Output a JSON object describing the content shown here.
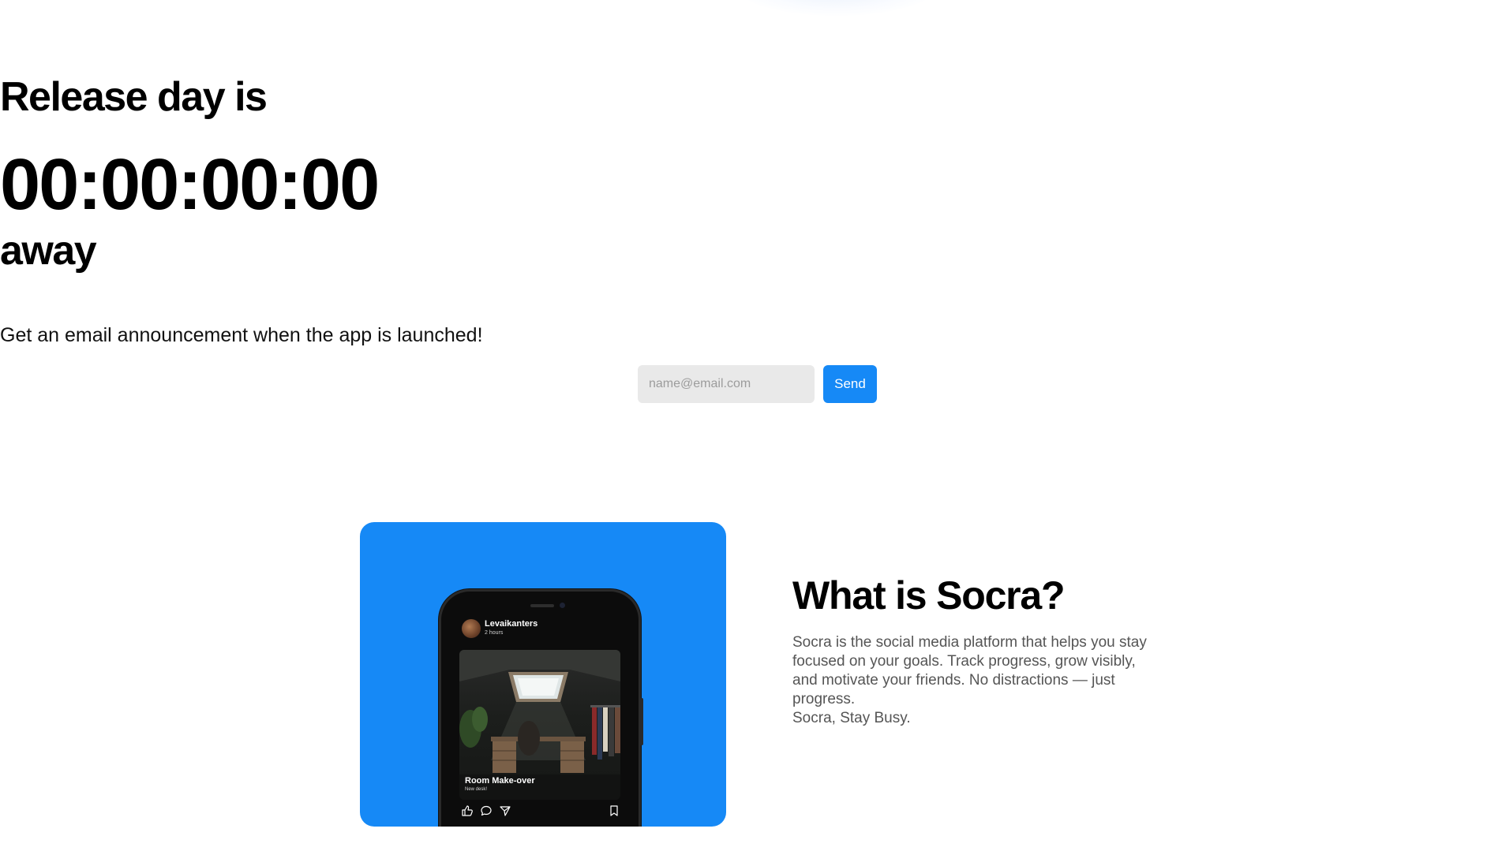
{
  "hero": {
    "headline": "Release day is",
    "countdown": "00:00:00:00",
    "suffix": "away",
    "subtitle": "Get an email announcement when the app is launched!"
  },
  "signup": {
    "email_placeholder": "name@email.com",
    "email_value": "",
    "send_label": "Send"
  },
  "feature": {
    "title": "What is Socra?",
    "description": "Socra is the social media platform that helps you stay focused on your goals. Track progress, grow visibly, and motivate your friends. No distractions — just progress.",
    "tagline": "Socra, Stay Busy.",
    "card_color": "#1689f6",
    "phone_post": {
      "username": "Levaikanters",
      "time": "2 hours",
      "caption_title": "Room Make-over",
      "caption_sub": "New desk!",
      "actions": [
        "like-icon",
        "comment-icon",
        "share-icon",
        "bookmark-icon"
      ]
    }
  },
  "colors": {
    "accent": "#1689f6",
    "input_bg": "#e9e9e9",
    "text": "#000000",
    "muted_text": "#555555"
  }
}
